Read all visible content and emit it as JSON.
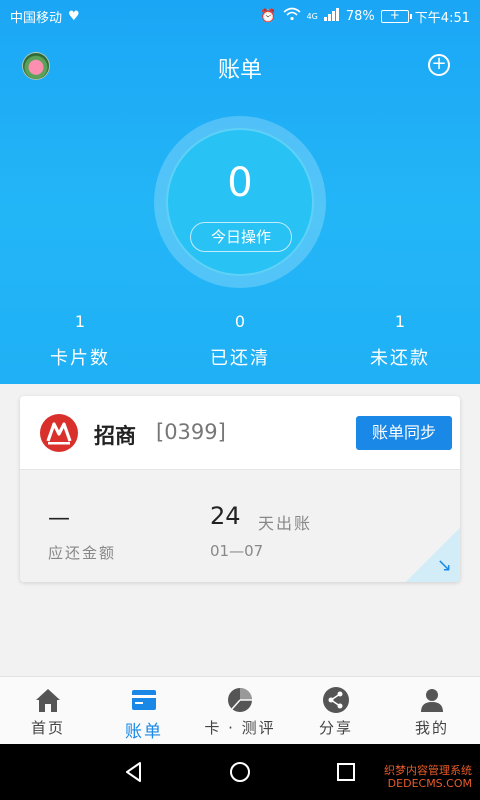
{
  "status_bar": {
    "carrier": "中国移动",
    "network": "4G",
    "battery": "78%",
    "time": "下午4:51"
  },
  "header": {
    "title": "账单",
    "today_count": "0",
    "today_label": "今日操作"
  },
  "stats": [
    {
      "value": "1",
      "label": "卡片数"
    },
    {
      "value": "0",
      "label": "已还清"
    },
    {
      "value": "1",
      "label": "未还款"
    }
  ],
  "card": {
    "bank_name": "招商",
    "card_number": "[0399]",
    "sync_label": "账单同步",
    "due_amount": "—",
    "due_label": "应还金额",
    "days_value": "24",
    "days_label": "天出账",
    "bill_date": "01—07"
  },
  "tabs": [
    {
      "label": "首页",
      "icon": "home-icon"
    },
    {
      "label": "账单",
      "icon": "bill-icon",
      "active": true
    },
    {
      "label": "卡 · 测评",
      "icon": "pie-chart-icon"
    },
    {
      "label": "分享",
      "icon": "share-icon"
    },
    {
      "label": "我的",
      "icon": "user-icon"
    }
  ],
  "watermark": {
    "line1": "织梦内容管理系统",
    "line2": "DEDECMS.COM"
  },
  "colors": {
    "header_blue": "#1ba6f5",
    "accent_blue": "#1a88e6",
    "bank_red": "#d9302c"
  }
}
